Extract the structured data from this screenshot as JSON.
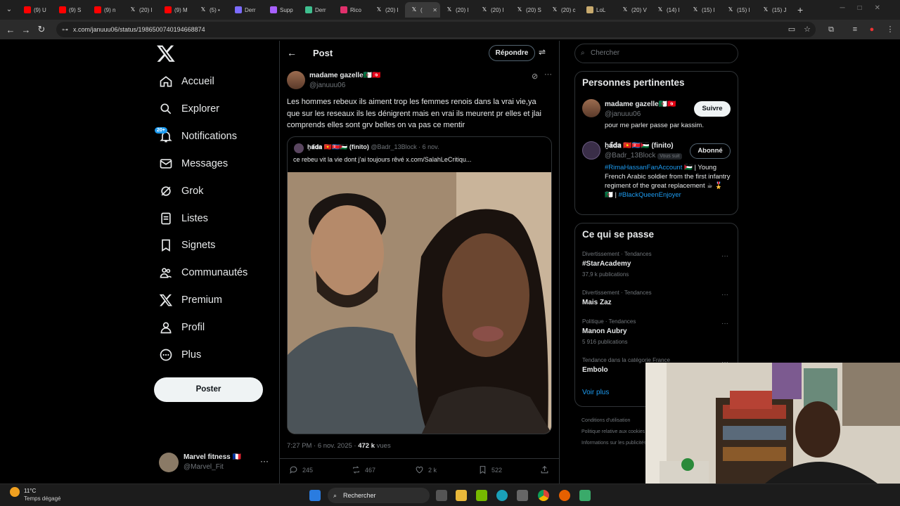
{
  "browser": {
    "tabs": [
      {
        "label": "(9) U",
        "icon": "youtube-icon",
        "color": "#ff0000"
      },
      {
        "label": "(9) S",
        "icon": "youtube-icon",
        "color": "#ff0000"
      },
      {
        "label": "(9) n",
        "icon": "youtube-icon",
        "color": "#ff0000"
      },
      {
        "label": "(20) I",
        "icon": "x-icon",
        "color": "#ffffff"
      },
      {
        "label": "(9) M",
        "icon": "youtube-icon",
        "color": "#ff0000"
      },
      {
        "label": "(5) •",
        "icon": "x-icon",
        "color": "#ffffff"
      },
      {
        "label": "Derr",
        "icon": "app-icon",
        "color": "#7c6cff"
      },
      {
        "label": "Supp",
        "icon": "app-icon",
        "color": "#a860ff"
      },
      {
        "label": "Derr",
        "icon": "sheet-icon",
        "color": "#3fbf8f"
      },
      {
        "label": "Rico",
        "icon": "instagram-icon",
        "color": "#e1306c"
      },
      {
        "label": "(20) I",
        "icon": "x-icon",
        "color": "#ffffff"
      },
      {
        "label": "(",
        "icon": "x-icon",
        "color": "#ffffff",
        "active": true
      },
      {
        "label": "(20) I",
        "icon": "x-icon",
        "color": "#ffffff"
      },
      {
        "label": "(20) I",
        "icon": "x-icon",
        "color": "#ffffff"
      },
      {
        "label": "(20) S",
        "icon": "x-icon",
        "color": "#ffffff"
      },
      {
        "label": "(20) c",
        "icon": "x-icon",
        "color": "#ffffff"
      },
      {
        "label": "LoL",
        "icon": "lol-icon",
        "color": "#c8aa6e"
      },
      {
        "label": "(20) V",
        "icon": "x-icon",
        "color": "#ffffff"
      },
      {
        "label": "(14) I",
        "icon": "x-icon",
        "color": "#ffffff"
      },
      {
        "label": "(15) I",
        "icon": "x-icon",
        "color": "#ffffff"
      },
      {
        "label": "(15) I",
        "icon": "x-icon",
        "color": "#ffffff"
      },
      {
        "label": "(15) J",
        "icon": "x-icon",
        "color": "#ffffff"
      }
    ],
    "url": "x.com/januuu06/status/1986500740194668874"
  },
  "sidebar": {
    "items": [
      {
        "label": "Accueil",
        "icon": "home-icon"
      },
      {
        "label": "Explorer",
        "icon": "search-icon"
      },
      {
        "label": "Notifications",
        "icon": "bell-icon"
      },
      {
        "label": "Messages",
        "icon": "mail-icon"
      },
      {
        "label": "Grok",
        "icon": "grok-icon"
      },
      {
        "label": "Listes",
        "icon": "list-icon"
      },
      {
        "label": "Signets",
        "icon": "bookmark-icon"
      },
      {
        "label": "Communautés",
        "icon": "people-icon"
      },
      {
        "label": "Premium",
        "icon": "x-logo-icon"
      },
      {
        "label": "Profil",
        "icon": "person-icon"
      },
      {
        "label": "Plus",
        "icon": "more-circle-icon"
      }
    ],
    "notif_badge": "20+",
    "post_button": "Poster",
    "account": {
      "name": "Marvel fitness 🇫🇷",
      "handle": "@Marvel_Fit"
    }
  },
  "post": {
    "header": "Post",
    "reply_button": "Répondre",
    "author_name": "madame gazelle🇩🇿🇹🇳",
    "author_handle": "@januuu06",
    "text": "Les hommes rebeux ils aiment trop les femmes renois dans la vrai vie,ya que sur les reseaux ils les dénigrent mais en vrai ils meurent pr elles et jlai comprends elles sont grv belles on va pas ce mentir",
    "quote": {
      "author": "ẖ𝐚̃𝐝𝐚 🇻🇳🇰🇵🇵🇸 (finito)",
      "handle": "@Badr_13Block",
      "date": "· 6 nov.",
      "text": "ce rebeu vit la vie dont j'ai toujours rêvé  x.com/SalahLeCritiqu..."
    },
    "timestamp": "7:27 PM · 6 nov. 2025 · ",
    "views_count": "472 k",
    "views_label": " vues",
    "stats": {
      "replies": "245",
      "reposts": "467",
      "likes": "2 k",
      "bookmarks": "522"
    }
  },
  "right": {
    "search_placeholder": "Chercher",
    "relevant_title": "Personnes pertinentes",
    "people": [
      {
        "name": "madame gazelle🇩🇿🇹🇳",
        "handle": "@januuu06",
        "button": "Suivre",
        "bio": "pour me parler passe par kassim."
      },
      {
        "name": "ẖ𝐚̃𝐝𝐚 🇻🇳🇰🇵🇵🇸 (finito)",
        "handle": "@Badr_13Block",
        "follows_you": "Vous suit",
        "button": "Abonné",
        "bio_hashtag1": "#RimaHassanFanAccount",
        "bio_text": " 🇵🇸 | Young French Arabic soldier from the first infantry regiment of the great replacement ☕ 🎖️🇩🇿 |",
        "bio_hashtag2": "#BlackQueenEnjoyer"
      }
    ],
    "trends_title": "Ce qui se passe",
    "trends": [
      {
        "meta": "Divertissement · Tendances",
        "name": "#StarAcademy",
        "count": "37,9 k publications"
      },
      {
        "meta": "Divertissement · Tendances",
        "name": "Mais Zaz",
        "count": ""
      },
      {
        "meta": "Politique · Tendances",
        "name": "Manon Aubry",
        "count": "5 916 publications"
      },
      {
        "meta": "Tendance dans la catégorie France",
        "name": "Embolo",
        "count": ""
      }
    ],
    "show_more": "Voir plus",
    "footer": [
      "Conditions d'utilisation",
      "Politique relative aux cookies",
      "Informations sur les publicités"
    ]
  },
  "taskbar": {
    "weather_temp": "11°C",
    "weather_desc": "Temps dégagé",
    "search_label": "Rechercher"
  }
}
